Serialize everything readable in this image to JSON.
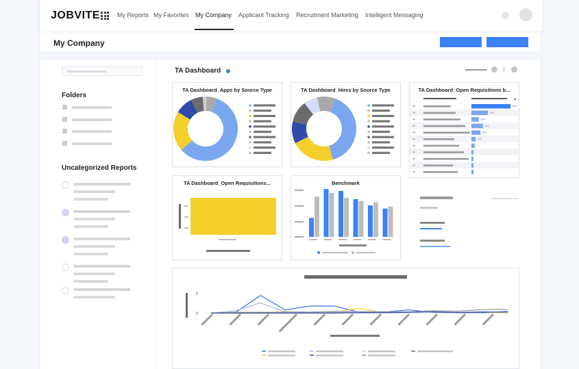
{
  "app": {
    "logo": "JOBVITE"
  },
  "nav": {
    "items": [
      {
        "label": "My Reports"
      },
      {
        "label": "My Favorites"
      },
      {
        "label": "My Company"
      },
      {
        "label": "Applicant Tracking"
      },
      {
        "label": "Recruitment Marketing"
      },
      {
        "label": "Intelligent Messaging"
      }
    ],
    "active": "My Company"
  },
  "header": {
    "title": "My Company"
  },
  "sidebar": {
    "folders_heading": "Folders",
    "uncategorized_heading": "Uncategorized Reports"
  },
  "dashboard": {
    "title": "TA Dashboard",
    "cards": {
      "apps_by_source": "TA Dashboard_Apps by Source Type",
      "hires_by_source": "TA Dashboard_Hires by Source Type",
      "open_req_table": "TA Dashboard_Open Requisitions b...",
      "open_req_bar": "TA Dashboard_Open Requisitions...",
      "benchmark": "Benchmark"
    }
  },
  "colors": {
    "accent": "#3b82f6",
    "light_blue": "#7aa7f0",
    "yellow": "#f5cf2a",
    "grey": "#bdbdbd",
    "dark_grey": "#6b6b6b",
    "navy": "#2f4aa8"
  },
  "chart_data": [
    {
      "type": "pie",
      "title": "TA Dashboard_Apps by Source Type",
      "donut": true,
      "slices": [
        {
          "value": 58,
          "color": "#7aa7f0"
        },
        {
          "value": 20,
          "color": "#f5cf2a"
        },
        {
          "value": 9,
          "color": "#2f4aa8"
        },
        {
          "value": 6,
          "color": "#6b6b6b"
        },
        {
          "value": 2,
          "color": "#d0d0d0"
        },
        {
          "value": 5,
          "color": "#a9a9a9"
        }
      ]
    },
    {
      "type": "pie",
      "title": "TA Dashboard_Hires by Source Type",
      "donut": true,
      "slices": [
        {
          "value": 40,
          "color": "#7aa7f0"
        },
        {
          "value": 22,
          "color": "#f5cf2a"
        },
        {
          "value": 11,
          "color": "#2f4aa8"
        },
        {
          "value": 11,
          "color": "#6b6b6b"
        },
        {
          "value": 7,
          "color": "#d6dcf5"
        },
        {
          "value": 9,
          "color": "#a9a9a9"
        }
      ]
    },
    {
      "type": "table",
      "title": "TA Dashboard_Open Requisitions b...",
      "bar_values": [
        95,
        40,
        18,
        28,
        22,
        10,
        8,
        5,
        3,
        3,
        3
      ]
    },
    {
      "type": "bar",
      "title": "TA Dashboard_Open Requisitions...",
      "values": [
        1
      ]
    },
    {
      "type": "bar",
      "title": "Benchmark",
      "series": [
        {
          "values": [
            30,
            76,
            73,
            60,
            50,
            45
          ],
          "color": "#3b82f6"
        },
        {
          "values": [
            64,
            70,
            62,
            57,
            55,
            48
          ],
          "color": "#bdbdbd"
        }
      ]
    },
    {
      "type": "line",
      "yticks": [
        "5",
        "0"
      ],
      "ylim": [
        -1,
        6
      ],
      "series": [
        {
          "values": [
            0,
            0.2,
            4.5,
            0.8,
            1.8,
            1.8,
            0.2,
            0.3,
            0.8,
            0.2,
            0.2,
            0.1,
            0.4
          ],
          "color": "#3b6fe0"
        },
        {
          "values": [
            0,
            0,
            0,
            0.4,
            0.2,
            0.3,
            1.2,
            0.1,
            0.2,
            0.6,
            0.2,
            0.2,
            0.1
          ],
          "color": "#f5cf2a"
        },
        {
          "values": [
            0,
            0.6,
            2.6,
            0.3,
            0.3,
            0.5,
            0.4,
            0.4,
            0.2,
            0.5,
            0.3,
            0.4,
            0.2
          ],
          "color": "#a9b8e8"
        },
        {
          "values": [
            0,
            0.2,
            0.2,
            0.2,
            0.2,
            0.2,
            0.3,
            0.3,
            0.3,
            0.6,
            0.5,
            0.9,
            0.9
          ],
          "color": "#9a9a9a"
        },
        {
          "values": [
            0,
            0,
            0,
            0,
            0,
            0,
            0.1,
            0.1,
            0.2,
            0.3,
            0.1,
            0.2,
            0.3
          ],
          "color": "#2f4aa8"
        }
      ]
    }
  ]
}
